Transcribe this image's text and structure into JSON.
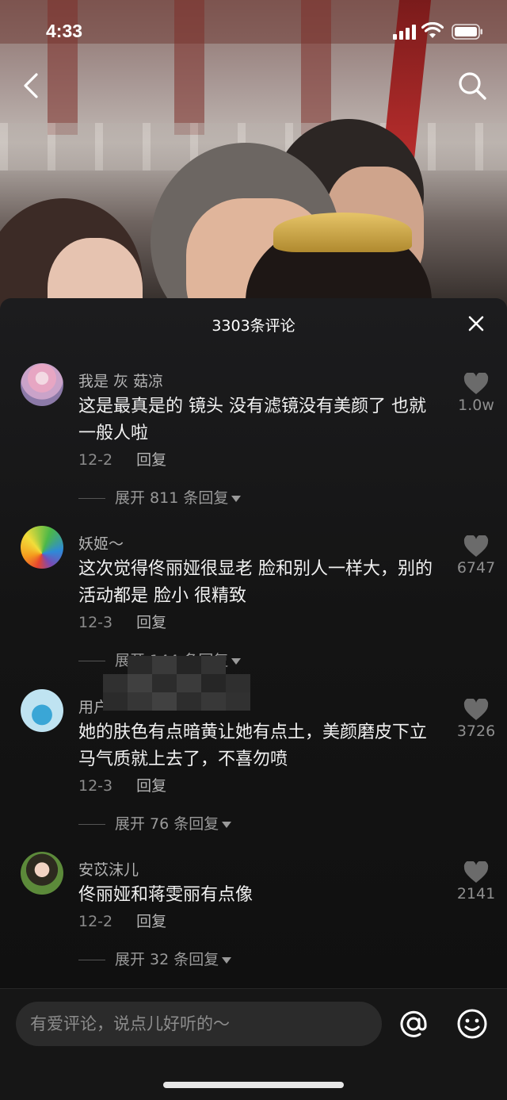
{
  "status_bar": {
    "time": "4:33"
  },
  "sheet": {
    "title": "3303条评论"
  },
  "comments": [
    {
      "username": "我是 灰 菇凉",
      "text": "这是最真是的 镜头 没有滤镜没有美颜了 也就一般人啦",
      "date": "12-2",
      "reply_label": "回复",
      "expand_label": "展开 811 条回复",
      "likes": "1.0w",
      "avatar_icon": "avatar-girl-pink"
    },
    {
      "username": "妖姬～",
      "text": "这次觉得佟丽娅很显老 脸和别人一样大，别的活动都是 脸小 很精致",
      "date": "12-3",
      "reply_label": "回复",
      "expand_label": "展开 144 条回复",
      "likes": "6747",
      "avatar_icon": "avatar-rainbow-road"
    },
    {
      "username": "用户",
      "text": "她的肤色有点暗黄让她有点土，美颜磨皮下立马气质就上去了，不喜勿喷",
      "date": "12-3",
      "reply_label": "回复",
      "expand_label": "展开 76 条回复",
      "likes": "3726",
      "avatar_icon": "avatar-cartoon-blue"
    },
    {
      "username": "安苡沫儿",
      "text": "佟丽娅和蒋雯丽有点像",
      "date": "12-2",
      "reply_label": "回复",
      "expand_label": "展开 32 条回复",
      "likes": "2141",
      "avatar_icon": "avatar-girl-green"
    }
  ],
  "input": {
    "placeholder": "有爱评论，说点儿好听的～"
  },
  "icons": {
    "back": "chevron-left-icon",
    "search": "search-icon",
    "close": "close-icon",
    "like": "heart-icon",
    "at": "at-sign-icon",
    "emoji": "emoji-icon"
  },
  "colors": {
    "sheet_bg": "#1c1c1e",
    "text_primary": "#f1f1f1",
    "text_secondary": "#8b8b8b"
  }
}
